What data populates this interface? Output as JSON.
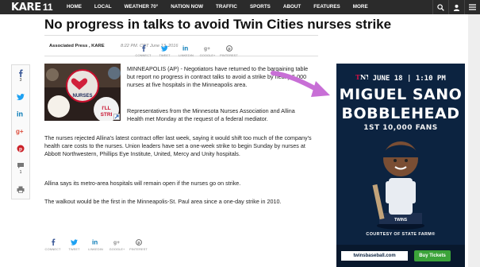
{
  "nav": {
    "logo_text": "KARE",
    "logo_mark": "11",
    "items": [
      "HOME",
      "LOCAL",
      "WEATHER 70°",
      "NATION NOW",
      "TRAFFIC",
      "SPORTS",
      "ABOUT",
      "FEATURES",
      "MORE"
    ]
  },
  "article": {
    "headline": "No progress in talks to avoid Twin Cities nurses strike",
    "byline": "Associated Press , KARE",
    "timestamp": "8:22 PM. CDT June 13, 2016",
    "paragraphs": [
      "MINNEAPOLIS (AP) - Negotiators have returned to the bargaining table but report no progress in contract talks to avoid a strike by nearly 5,000 nurses at five hospitals in the Minneapolis area.",
      "Representatives from the Minnesota Nurses Association and Allina Health met Monday at the request of a federal mediator.",
      "The nurses rejected Allina's latest contract offer last week, saying it would shift too much of the company's health care costs to the nurses. Union leaders have set a one-week strike to begin Sunday by nurses at Abbott Northwestern, Phillips Eye Institute, United, Mercy and Unity hospitals.",
      "Allina says its metro-area hospitals will remain open if the nurses go on strike.",
      "The walkout would be the first in the Minneapolis-St. Paul area since a one-day strike in 2010."
    ],
    "image": {
      "button_text": "NURSES",
      "button_text2": "I'LL",
      "button_text3": "STRI"
    }
  },
  "share_top": [
    "CONNECT",
    "TWEET",
    "LINKEDIN",
    "GOOGLE+",
    "PINTEREST"
  ],
  "share_bottom": [
    "CONNECT",
    "TWEET",
    "LINKEDIN",
    "GOOGLE+",
    "PINTEREST"
  ],
  "sidebar": {
    "facebook_count": "3",
    "comment_count": "1"
  },
  "ad": {
    "date_line": "JUNE 18 | 1:10 PM",
    "title_line1": "MIGUEL SANO",
    "title_line2": "BOBBLEHEAD",
    "subtitle": "1ST 10,000 FANS",
    "courtesy": "COURTESY OF STATE FARM®",
    "link": "twinsbaseball.com",
    "button": "Buy Tickets",
    "colors": {
      "navy": "#0c2340",
      "green": "#3ba339"
    }
  },
  "colors": {
    "arrow": "#c86fd6",
    "nav_bg": "#2b2b2b"
  }
}
